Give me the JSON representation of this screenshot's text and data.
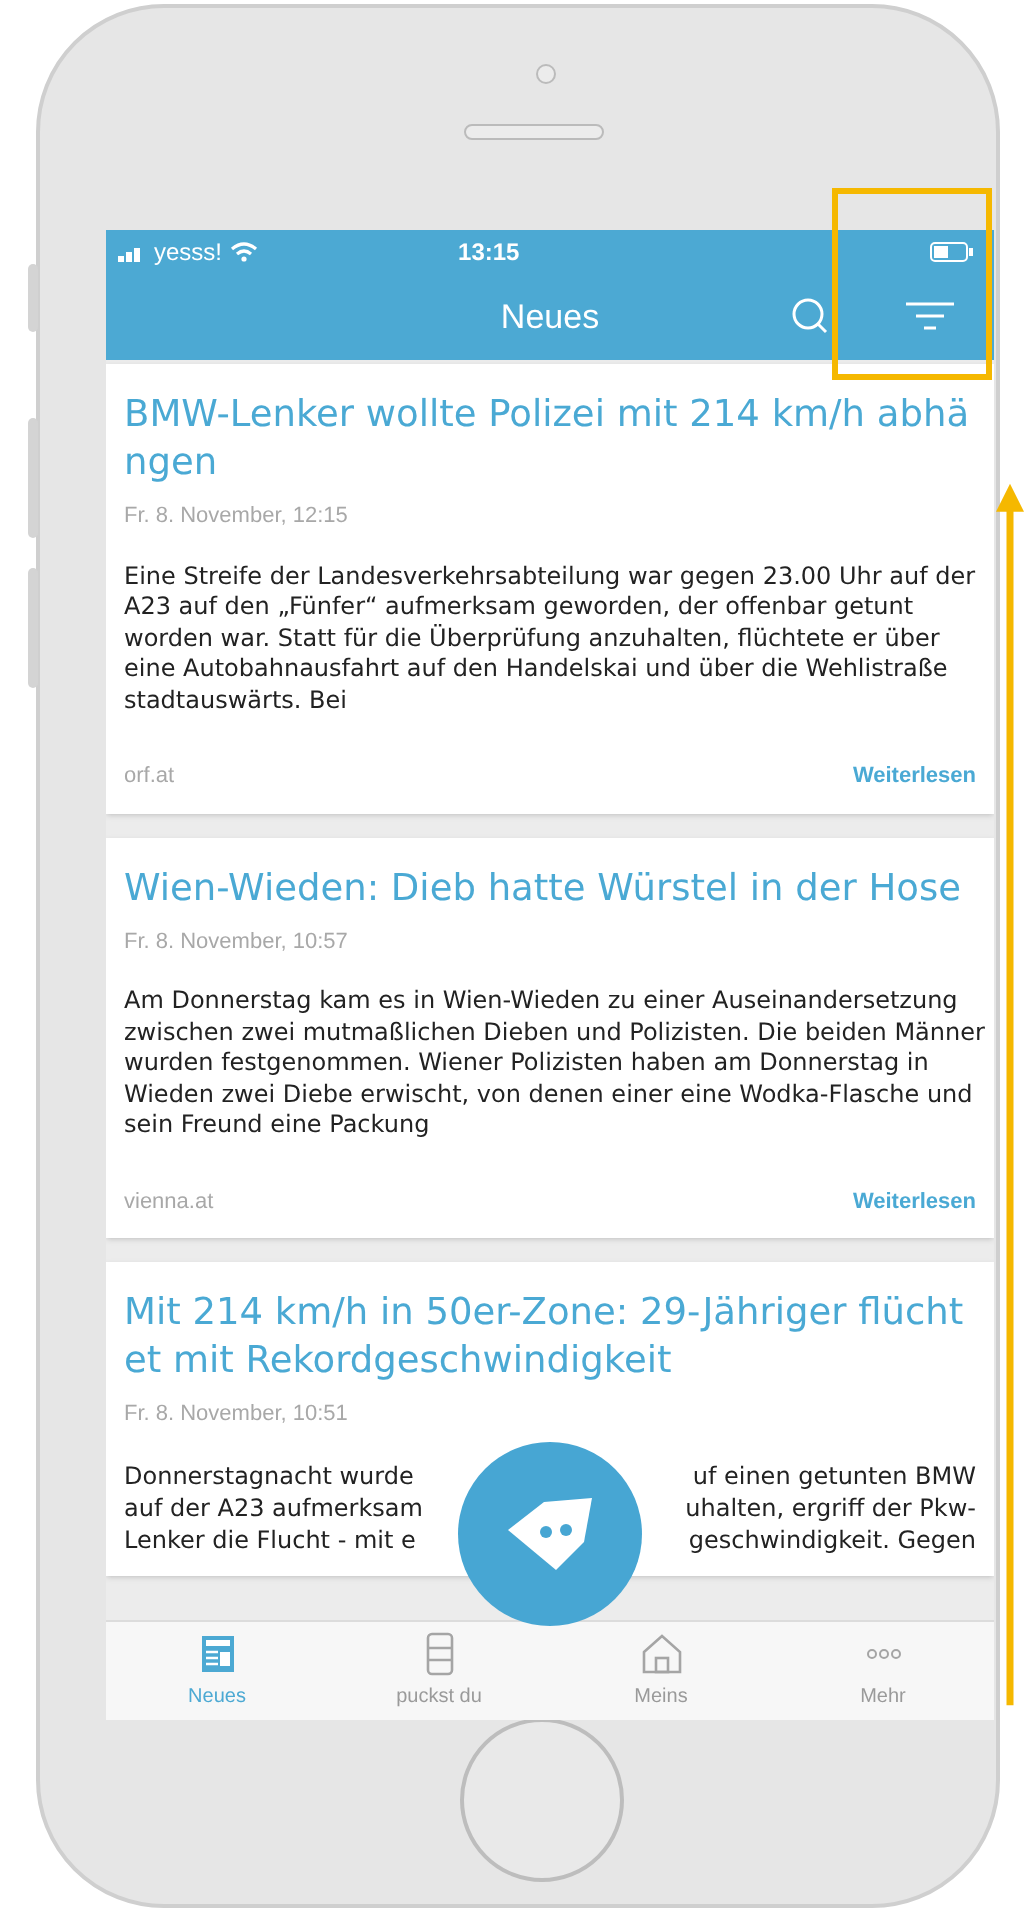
{
  "status_bar": {
    "carrier": "yesss!",
    "time": "13:15"
  },
  "nav": {
    "title": "Neues"
  },
  "articles": [
    {
      "title": "BMW-Lenker wollte Polizei mit 214 km/h abhängen",
      "date": "Fr. 8. November, 12:15",
      "body": "Eine Streife der Landesverkehrsabteilung war gegen 23.00 Uhr auf der A23 auf den „Fünfer“ aufmerksam geworden, der offenbar getunt worden war. Statt für die Überprüfung anzuhalten, flüchtete er über eine Autobahnausfahrt auf den Handelskai und über die Wehlistraße stadtauswärts. Bei",
      "source": "orf.at",
      "link": "Weiterlesen"
    },
    {
      "title": "Wien-Wieden: Dieb hatte Würstel in der Hose",
      "date": "Fr. 8. November, 10:57",
      "body": "Am Donnerstag kam es in Wien-Wieden zu einer Auseinandersetzung zwischen zwei mutmaßlichen Dieben und Polizisten. Die beiden Männer wurden festgenommen. Wiener Polizisten haben am Donnerstag in Wieden zwei Diebe erwischt, von denen einer eine Wodka-Flasche und sein Freund eine Packung",
      "source": "vienna.at",
      "link": "Weiterlesen"
    },
    {
      "title": "Mit 214 km/h in 50er-Zone: 29-Jähriger flüchtet mit Rekordgeschwindigkeit",
      "date": "Fr. 8. November, 10:51",
      "body_lines": [
        [
          "Donnerstagnacht wurde",
          "uf einen getunten BMW"
        ],
        [
          "auf der A23 aufmerksam",
          "uhalten, ergriff der Pkw-"
        ],
        [
          "Lenker die Flucht - mit e",
          "geschwindigkeit. Gegen"
        ]
      ]
    }
  ],
  "tabs": [
    {
      "label": "Neues",
      "selected": true
    },
    {
      "label": "puckst du",
      "selected": false
    },
    {
      "label": "Meins",
      "selected": false
    },
    {
      "label": "Mehr",
      "selected": false
    }
  ]
}
